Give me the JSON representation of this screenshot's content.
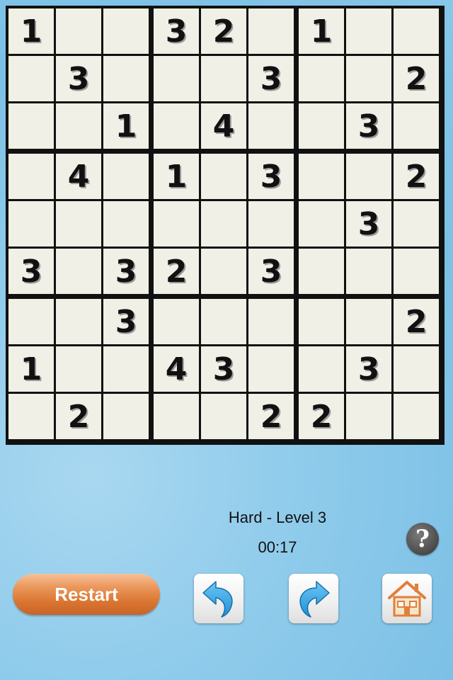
{
  "board": {
    "rows": [
      [
        "1",
        "",
        "",
        "3",
        "2",
        "",
        "1",
        "",
        ""
      ],
      [
        "",
        "3",
        "",
        "",
        "",
        "3",
        "",
        "",
        "2"
      ],
      [
        "",
        "",
        "1",
        "",
        "4",
        "",
        "",
        "3",
        ""
      ],
      [
        "",
        "4",
        "",
        "1",
        "",
        "3",
        "",
        "",
        "2"
      ],
      [
        "",
        "",
        "",
        "",
        "",
        "",
        "",
        "3",
        ""
      ],
      [
        "3",
        "",
        "3",
        "2",
        "",
        "3",
        "",
        "",
        ""
      ],
      [
        "",
        "",
        "3",
        "",
        "",
        "",
        "",
        "",
        "2"
      ],
      [
        "1",
        "",
        "",
        "4",
        "3",
        "",
        "",
        "3",
        ""
      ],
      [
        "",
        "2",
        "",
        "",
        "",
        "2",
        "2",
        "",
        ""
      ]
    ]
  },
  "status": {
    "level_label": "Hard - Level 3",
    "timer": "00:17"
  },
  "controls": {
    "restart_label": "Restart",
    "help_symbol": "?",
    "undo_icon": "undo-arrow-icon",
    "redo_icon": "redo-arrow-icon",
    "home_icon": "home-icon",
    "accent_color": "#e0803c"
  }
}
